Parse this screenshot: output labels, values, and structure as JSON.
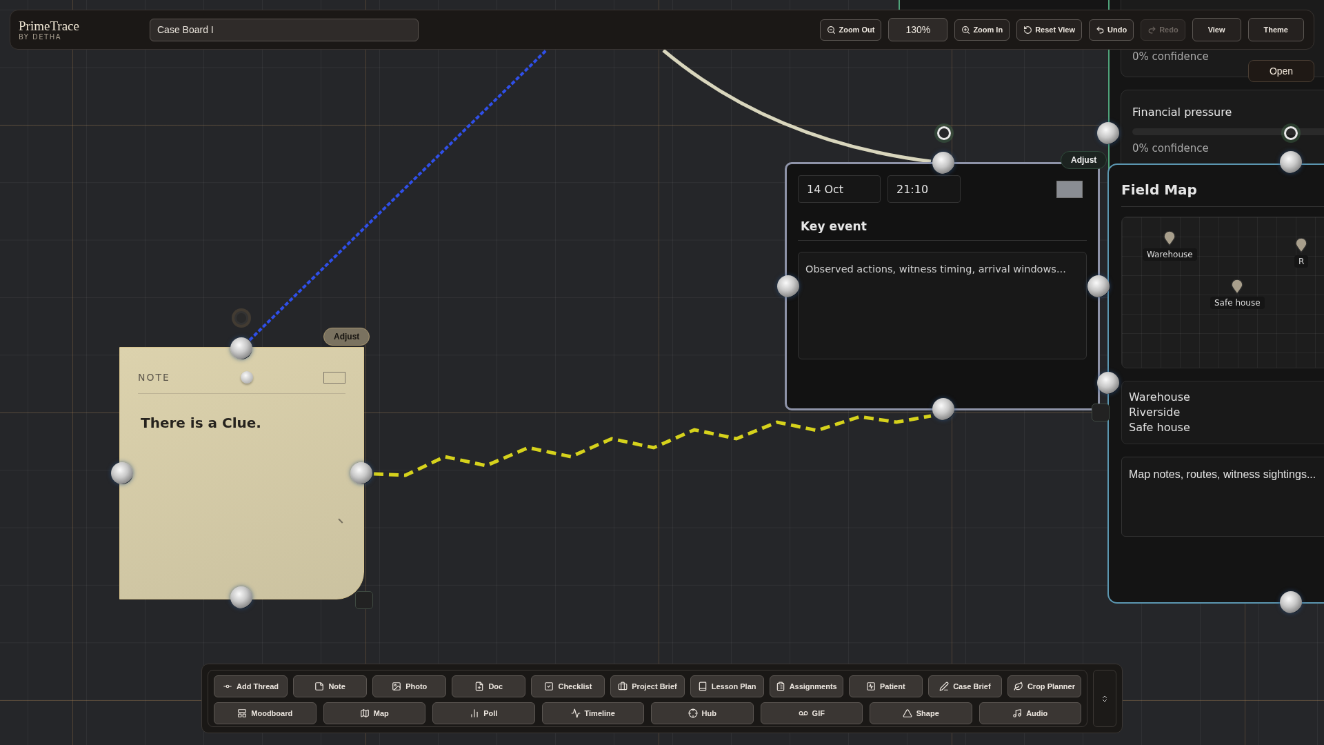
{
  "app": {
    "name": "PrimeTrace",
    "byline": "BY DETHA"
  },
  "board_name": {
    "value": "Case Board I"
  },
  "view_controls": [
    {
      "label": "Zoom Out",
      "kind": "zoom_out",
      "disabled": false
    },
    {
      "label": "130%",
      "kind": "readout",
      "disabled": false
    },
    {
      "label": "Zoom In",
      "kind": "zoom_in",
      "disabled": false
    },
    {
      "label": "Reset View",
      "kind": "reset",
      "disabled": false
    },
    {
      "label": "Undo",
      "kind": "undo",
      "disabled": false
    },
    {
      "label": "Redo",
      "kind": "redo",
      "disabled": true
    },
    {
      "label": "View",
      "kind": "plain",
      "disabled": false
    },
    {
      "label": "Theme",
      "kind": "plain",
      "disabled": false
    }
  ],
  "threads": [
    {
      "color": "#2f4fe8",
      "kind": "dashed"
    },
    {
      "color": "#d9d6bd",
      "kind": "solid"
    },
    {
      "color": "#d6d21c",
      "kind": "dashed"
    }
  ],
  "note_card": {
    "label": "NOTE",
    "text": "There is a Clue.",
    "adjust": "Adjust"
  },
  "timeline_card": {
    "date": "14 Oct",
    "time": "21:10",
    "title": "Key event",
    "notes_placeholder": "Observed actions, witness timing, arrival windows...",
    "adjust": "Adjust"
  },
  "hypotheses": [
    {
      "confidence": "0% confidence"
    },
    {
      "title": "Financial pressure",
      "confidence": "0% confidence"
    }
  ],
  "open_button": "Open",
  "field_map": {
    "title": "Field Map",
    "pins": [
      {
        "label": "Warehouse"
      },
      {
        "label": "Safe house"
      },
      {
        "label": "R"
      }
    ],
    "locations": [
      "Warehouse",
      "Riverside",
      "Safe house"
    ],
    "notes_placeholder": "Map notes, routes, witness sightings..."
  },
  "palette": [
    {
      "label": "Add Thread"
    },
    {
      "label": "Note"
    },
    {
      "label": "Photo"
    },
    {
      "label": "Doc"
    },
    {
      "label": "Checklist"
    },
    {
      "label": "Project Brief"
    },
    {
      "label": "Lesson Plan"
    },
    {
      "label": "Assignments"
    },
    {
      "label": "Patient"
    },
    {
      "label": "Case Brief"
    },
    {
      "label": "Crop Planner"
    },
    {
      "label": "Moodboard"
    },
    {
      "label": "Map"
    },
    {
      "label": "Poll"
    },
    {
      "label": "Timeline"
    },
    {
      "label": "Hub"
    },
    {
      "label": "GIF"
    },
    {
      "label": "Shape"
    },
    {
      "label": "Audio"
    }
  ]
}
